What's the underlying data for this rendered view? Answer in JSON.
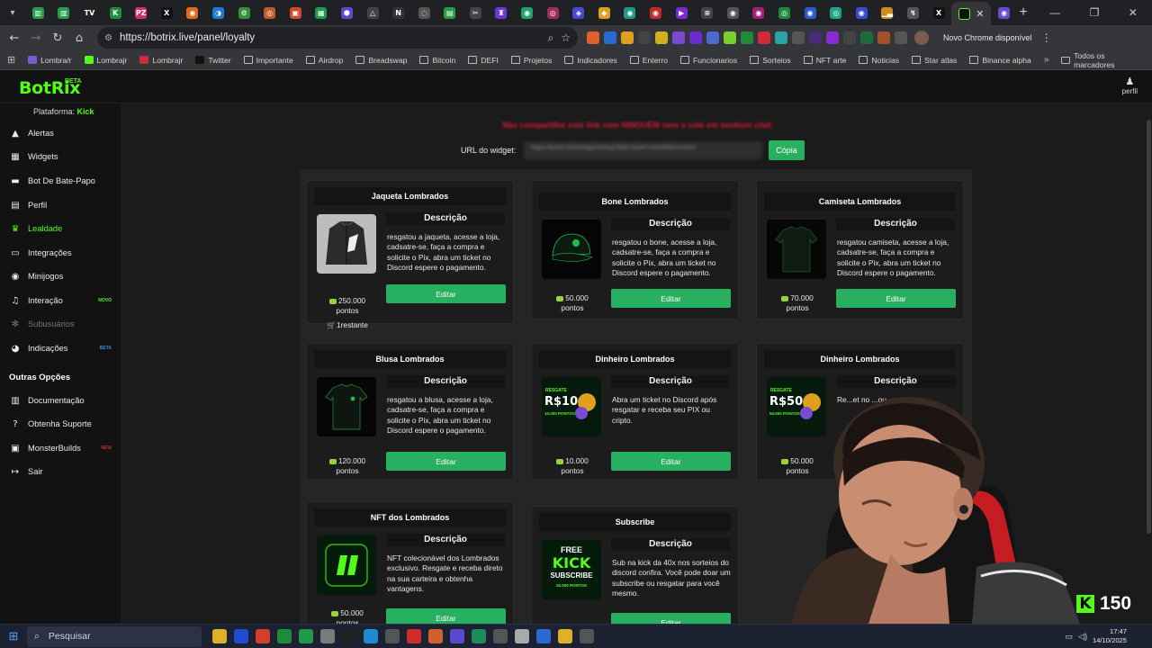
{
  "browser": {
    "url": "https://botrix.live/panel/loyalty",
    "update_chip": "Novo Chrome disponível",
    "tabs": [
      {
        "glyph": "▥",
        "color": "#2a9d4b"
      },
      {
        "glyph": "▥",
        "color": "#2a9d4b"
      },
      {
        "glyph": "TV",
        "color": "#222222"
      },
      {
        "glyph": "K",
        "color": "#1f8f3a"
      },
      {
        "glyph": "PZ",
        "color": "#d12e6b"
      },
      {
        "glyph": "X",
        "color": "#111111"
      },
      {
        "glyph": "◉",
        "color": "#e06a1f"
      },
      {
        "glyph": "◑",
        "color": "#1f7ad1"
      },
      {
        "glyph": "⚙",
        "color": "#3a8f3a"
      },
      {
        "glyph": "◎",
        "color": "#c25a2b"
      },
      {
        "glyph": "▣",
        "color": "#d14a2b"
      },
      {
        "glyph": "▦",
        "color": "#1f9a4a"
      },
      {
        "glyph": "⬢",
        "color": "#5a4ad1"
      },
      {
        "glyph": "△",
        "color": "#444444"
      },
      {
        "glyph": "N",
        "color": "#333333"
      },
      {
        "glyph": "◌",
        "color": "#555555"
      },
      {
        "glyph": "▤",
        "color": "#2a9d4b"
      },
      {
        "glyph": "✂",
        "color": "#444444"
      },
      {
        "glyph": "♜",
        "color": "#6a3ad1"
      },
      {
        "glyph": "◉",
        "color": "#1fa36a"
      },
      {
        "glyph": "◎",
        "color": "#a32b5a"
      },
      {
        "glyph": "◈",
        "color": "#4a4ad1"
      },
      {
        "glyph": "◆",
        "color": "#e0a01f"
      },
      {
        "glyph": "◉",
        "color": "#1f9a8a"
      },
      {
        "glyph": "◉",
        "color": "#c22b2b"
      },
      {
        "glyph": "▶",
        "color": "#7a2bd1"
      },
      {
        "glyph": "≡",
        "color": "#444444"
      },
      {
        "glyph": "◉",
        "color": "#555555"
      },
      {
        "glyph": "◉",
        "color": "#a31f7a"
      },
      {
        "glyph": "◎",
        "color": "#1f8a3a"
      },
      {
        "glyph": "◉",
        "color": "#2b5ad1"
      },
      {
        "glyph": "◎",
        "color": "#1fa38a"
      },
      {
        "glyph": "◉",
        "color": "#3a4ad1"
      },
      {
        "glyph": "▁▃",
        "color": "#d18a1f"
      },
      {
        "glyph": "↯",
        "color": "#555555"
      },
      {
        "glyph": "X",
        "color": "#111111"
      },
      {
        "glyph": "◉",
        "color": "#6a4ad1"
      },
      {
        "glyph": "✂",
        "color": "#444444"
      }
    ],
    "extensions": [
      "#e0602b",
      "#2b6ad1",
      "#e0a01f",
      "#444444",
      "#d1b01f",
      "#7a4ad1",
      "#6a2bd1",
      "#4a6ad1",
      "#7ad12b",
      "#1f8a3a",
      "#d12b3a",
      "#2ba3a3",
      "#555555",
      "#4a2b7a",
      "#8a2bd1",
      "#444444",
      "#1f6a3a",
      "#a3502b",
      "#555555"
    ]
  },
  "bookmarks": [
    {
      "label": "Lombra/r",
      "icon": "#7a5ad1"
    },
    {
      "label": "Lombrajr",
      "icon": "#53fc18"
    },
    {
      "label": "Lombrajr",
      "icon": "#d12b3a"
    },
    {
      "label": "Twitter",
      "icon": "#111111"
    },
    {
      "label": "Importante",
      "icon": "folder"
    },
    {
      "label": "Airdrop",
      "icon": "folder"
    },
    {
      "label": "Breadswap",
      "icon": "folder"
    },
    {
      "label": "Bitcoin",
      "icon": "folder"
    },
    {
      "label": "DEFI",
      "icon": "folder"
    },
    {
      "label": "Projetos",
      "icon": "folder"
    },
    {
      "label": "Indicadores",
      "icon": "folder"
    },
    {
      "label": "Enterro",
      "icon": "folder"
    },
    {
      "label": "Funcionarios",
      "icon": "folder"
    },
    {
      "label": "Sorteios",
      "icon": "folder"
    },
    {
      "label": "NFT arte",
      "icon": "folder"
    },
    {
      "label": "Noticias",
      "icon": "folder"
    },
    {
      "label": "Star atlas",
      "icon": "folder"
    },
    {
      "label": "Binance alpha",
      "icon": "folder"
    }
  ],
  "bookmarks_all": "Todos os marcadores",
  "app": {
    "logo": "BotRix",
    "beta": "BETA",
    "profile_label": "perfil",
    "platform_label": "Plataforma:",
    "platform_value": "Kick",
    "other_options": "Outras Opções"
  },
  "nav": [
    {
      "label": "Alertas",
      "icon": "alert-icon",
      "glyph": "▲",
      "state": ""
    },
    {
      "label": "Widgets",
      "icon": "widgets-icon",
      "glyph": "▦",
      "state": ""
    },
    {
      "label": "Bot De Bate-Papo",
      "icon": "chat-icon",
      "glyph": "▬",
      "state": ""
    },
    {
      "label": "Perfil",
      "icon": "profile-icon",
      "glyph": "▤",
      "state": ""
    },
    {
      "label": "Lealdade",
      "icon": "trophy-icon",
      "glyph": "♛",
      "state": "active"
    },
    {
      "label": "Integrações",
      "icon": "integrations-icon",
      "glyph": "▭",
      "state": ""
    },
    {
      "label": "Minijogos",
      "icon": "gamepad-icon",
      "glyph": "◉",
      "state": ""
    },
    {
      "label": "Interação",
      "icon": "music-icon",
      "glyph": "♫",
      "state": "",
      "badge": "NOVO",
      "badge_color": "#53fc18"
    },
    {
      "label": "Subusuários",
      "icon": "subusers-icon",
      "glyph": "✻",
      "state": "muted"
    },
    {
      "label": "Indicações",
      "icon": "referrals-icon",
      "glyph": "◕",
      "state": "",
      "badge": "BETA",
      "badge_color": "#3a8de0"
    }
  ],
  "nav_other": [
    {
      "label": "Documentação",
      "icon": "docs-icon",
      "glyph": "▥"
    },
    {
      "label": "Obtenha Suporte",
      "icon": "help-icon",
      "glyph": "?"
    },
    {
      "label": "MonsterBuilds",
      "icon": "monitor-icon",
      "glyph": "▣",
      "badge": "NEW",
      "badge_color": "#c22b2b"
    },
    {
      "label": "Sair",
      "icon": "logout-icon",
      "glyph": "↦"
    }
  ],
  "loyalty": {
    "warning": "Não compartilhe este link com NINGUÉM nem o cole em nenhum chat.",
    "widget_label": "URL do widget:",
    "widget_url": "https://botrix.live/widgets/shop?bid=3ueH7u4mWkRm2eK4",
    "copy": "Cópia",
    "desc_heading": "Descrição",
    "edit": "Editar",
    "rewards": [
      {
        "title": "Jaqueta Lombrados",
        "desc": "resgatou a jaqueta, acesse a loja, cadsatre-se, faça a compra e solicite o Pix, abra um ticket no Discord espere o pagamento.",
        "points": "250.000",
        "points_unit": "pontos",
        "remaining": "1restante",
        "image": "jacket"
      },
      {
        "title": "Bone Lombrados",
        "desc": "resgatou o bone, acesse a loja, cadsatre-se, faça a compra e solicite o Pix, abra um ticket no Discord espere o pagamento.",
        "points": "50.000",
        "points_unit": "pontos",
        "image": "cap"
      },
      {
        "title": "Camiseta Lombrados",
        "desc": "resgatou camiseta, acesse a loja, cadsatre-se, faça a compra e solicite o Pix, abra um ticket no Discord espere o pagamento.",
        "points": "70.000",
        "points_unit": "pontos",
        "image": "tshirt"
      },
      {
        "title": "Blusa Lombrados",
        "desc": "resgatou a blusa, acesse a loja, cadsatre-se, faça a compra e solicite o Pix, abra um ticket no Discord espere o pagamento.",
        "points": "120.000",
        "points_unit": "pontos",
        "image": "shirt"
      },
      {
        "title": "Dinheiro Lombrados",
        "desc": "Abra um ticket no Discord após resgatar e receba seu PIX ou cripto.",
        "points": "10.000",
        "points_unit": "pontos",
        "image": "money10",
        "img_top": "RESGATE",
        "img_main": "R$10",
        "img_sub": "10.000 PONTOS"
      },
      {
        "title": "Dinheiro Lombrados",
        "desc": "Re...et no ...ou",
        "points": "50.000",
        "points_unit": "pontos",
        "image": "money50",
        "img_top": "RESGATE",
        "img_main": "R$50",
        "img_sub": "50.000 PONTOS"
      },
      {
        "title": "NFT dos Lombrados",
        "desc": "NFT colecionável dos Lombrados exclusivo. Resgate e receba direto na sua carteira e obtenha vantagens.",
        "points": "50.000",
        "points_unit": "pontos",
        "image": "nft"
      },
      {
        "title": "Subscribe",
        "desc": "Sub na kick da 40x nos sorteios do discord confira. Você pode doar um subscribe ou resgatar para você mesmo.",
        "points": "25.000",
        "points_unit": "pontos",
        "image": "sub",
        "img_top": "FREE",
        "img_main": "KICK",
        "img_mid": "SUBSCRIBE",
        "img_sub": "25.000 PONTOS"
      }
    ]
  },
  "stream_overlay": {
    "counter": "150"
  },
  "taskbar": {
    "search": "Pesquisar",
    "time": "17:47",
    "date": "14/10/2025",
    "apps": [
      "#e0b02b",
      "#1f4ad1",
      "#d1402b",
      "#1f8a3a",
      "#1f9a4a",
      "#7a7a7a",
      "#222222",
      "#1f8ad1",
      "#555555",
      "#d12b2b",
      "#d1602b",
      "#5a4ad1",
      "#1f8a5a",
      "#555555",
      "#aaaaaa",
      "#2b6ad1",
      "#e0b02b",
      "#555555"
    ]
  },
  "colors": {
    "accent": "#53fc18",
    "button": "#27b060",
    "warning": "#d2193a"
  }
}
